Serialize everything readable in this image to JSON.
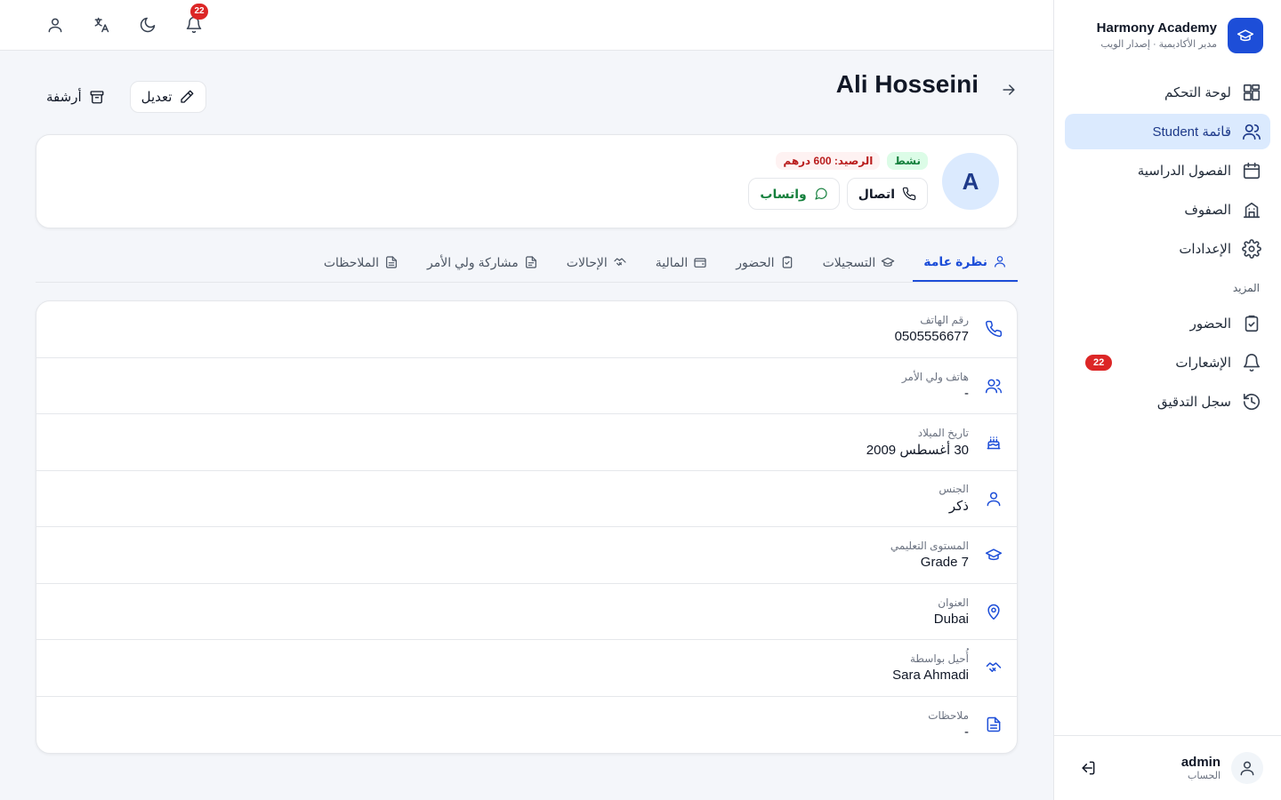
{
  "brand": {
    "title": "Harmony Academy",
    "subtitle": "مدير الأكاديمية · إصدار الويب",
    "color": "#1d4ed8"
  },
  "sidebar": {
    "items": [
      {
        "label": "لوحة التحكم",
        "icon": "dashboard-icon"
      },
      {
        "label": "قائمة Student",
        "icon": "users-icon",
        "active": true
      },
      {
        "label": "الفصول الدراسية",
        "icon": "calendar-icon"
      },
      {
        "label": "الصفوف",
        "icon": "building-icon"
      },
      {
        "label": "الإعدادات",
        "icon": "gear-icon"
      }
    ],
    "section_label": "المزيد",
    "more_items": [
      {
        "label": "الحضور",
        "icon": "clipboard-check-icon"
      },
      {
        "label": "الإشعارات",
        "icon": "bell-icon",
        "badge": "22"
      },
      {
        "label": "سجل التدقيق",
        "icon": "history-icon"
      }
    ],
    "account": {
      "name": "admin",
      "role": "الحساب"
    }
  },
  "topbar": {
    "notification_count": "22"
  },
  "student": {
    "name": "Ali Hosseini",
    "initial": "A",
    "status": "نشط",
    "balance": "الرصيد: 600 درهم",
    "call_label": "اتصال",
    "whatsapp_label": "واتساب"
  },
  "actions": {
    "edit_label": "تعديل",
    "archive_label": "أرشفة"
  },
  "tabs": [
    {
      "label": "نظرة عامة",
      "icon": "user-icon",
      "active": true
    },
    {
      "label": "التسجيلات",
      "icon": "graduation-cap-icon"
    },
    {
      "label": "الحضور",
      "icon": "clipboard-check-icon"
    },
    {
      "label": "المالية",
      "icon": "wallet-icon"
    },
    {
      "label": "الإحالات",
      "icon": "handshake-icon"
    },
    {
      "label": "مشاركة ولي الأمر",
      "icon": "file-icon"
    },
    {
      "label": "الملاحظات",
      "icon": "file-text-icon"
    }
  ],
  "info": [
    {
      "label": "رقم الهاتف",
      "value": "0505556677",
      "icon": "phone-icon"
    },
    {
      "label": "هاتف ولي الأمر",
      "value": "-",
      "icon": "users-icon"
    },
    {
      "label": "تاريخ الميلاد",
      "value": "30 أغسطس 2009",
      "icon": "cake-icon"
    },
    {
      "label": "الجنس",
      "value": "ذكر",
      "icon": "user-icon"
    },
    {
      "label": "المستوى التعليمي",
      "value": "Grade 7",
      "icon": "graduation-cap-icon"
    },
    {
      "label": "العنوان",
      "value": "Dubai",
      "icon": "map-pin-icon"
    },
    {
      "label": "أُحيل بواسطة",
      "value": "Sara Ahmadi",
      "icon": "handshake-icon"
    },
    {
      "label": "ملاحظات",
      "value": "-",
      "icon": "file-text-icon"
    }
  ]
}
